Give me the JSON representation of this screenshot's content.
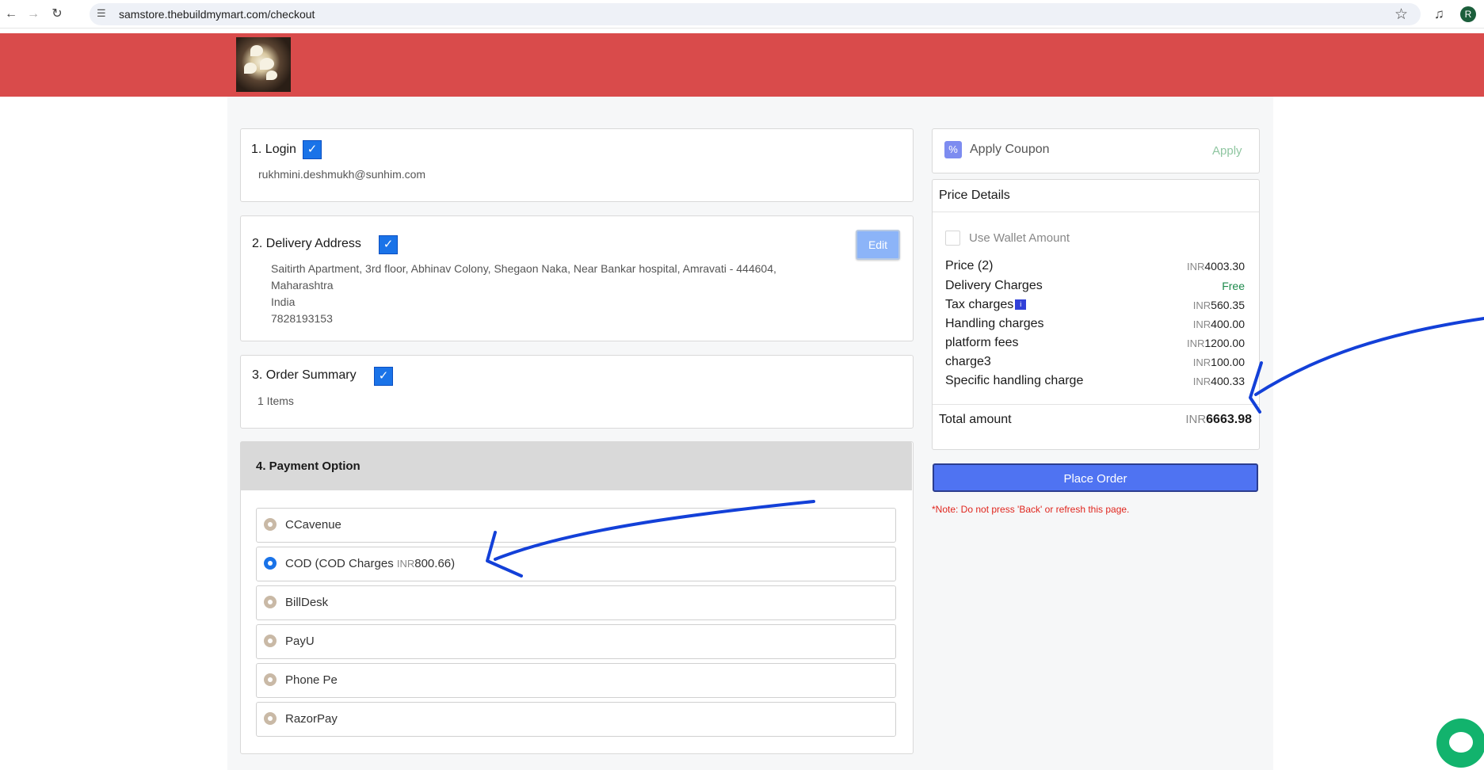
{
  "browser": {
    "url": "samstore.thebuildmymart.com/checkout",
    "profile_initial": "R"
  },
  "sections": {
    "login": {
      "title": "1. Login",
      "email": "rukhmini.deshmukh@sunhim.com"
    },
    "delivery": {
      "title": "2. Delivery Address",
      "edit_label": "Edit",
      "address_line1": "Saitirth Apartment, 3rd floor, Abhinav Colony, Shegaon Naka, Near Bankar hospital, Amravati - 444604,",
      "address_line2": "Maharashtra",
      "country": "India",
      "phone": "7828193153"
    },
    "order_summary": {
      "title": "3. Order Summary",
      "items": "1 Items"
    },
    "payment": {
      "title": "4. Payment Option",
      "options": [
        {
          "label": "CCavenue",
          "selected": false
        },
        {
          "label": "COD (COD Charges ",
          "currency": "INR",
          "amount": "800.66)",
          "selected": true
        },
        {
          "label": "BillDesk",
          "selected": false
        },
        {
          "label": "PayU",
          "selected": false
        },
        {
          "label": "Phone Pe",
          "selected": false
        },
        {
          "label": "RazorPay",
          "selected": false
        }
      ]
    }
  },
  "coupon": {
    "label": "Apply Coupon",
    "apply": "Apply"
  },
  "price_details": {
    "title": "Price Details",
    "wallet_label": "Use Wallet Amount",
    "rows": [
      {
        "label": "Price (2)",
        "currency": "INR",
        "value": "4003.30"
      },
      {
        "label": "Delivery Charges",
        "currency": "",
        "value": "Free"
      },
      {
        "label": "Tax charges",
        "currency": "INR",
        "value": "560.35"
      },
      {
        "label": "Handling charges",
        "currency": "INR",
        "value": "400.00"
      },
      {
        "label": "platform fees",
        "currency": "INR",
        "value": "1200.00"
      },
      {
        "label": "charge3",
        "currency": "INR",
        "value": "100.00"
      },
      {
        "label": "Specific handling charge",
        "currency": "INR",
        "value": "400.33"
      }
    ],
    "total_label": "Total amount",
    "total_currency": "INR",
    "total_value": "6663.98"
  },
  "place_order_label": "Place Order",
  "note": "*Note: Do not press 'Back' or refresh this page.",
  "colors": {
    "header": "#d94b4b",
    "accent": "#1a73e8",
    "free": "#1e8a4c",
    "annotation_arrow": "#1340d8"
  }
}
